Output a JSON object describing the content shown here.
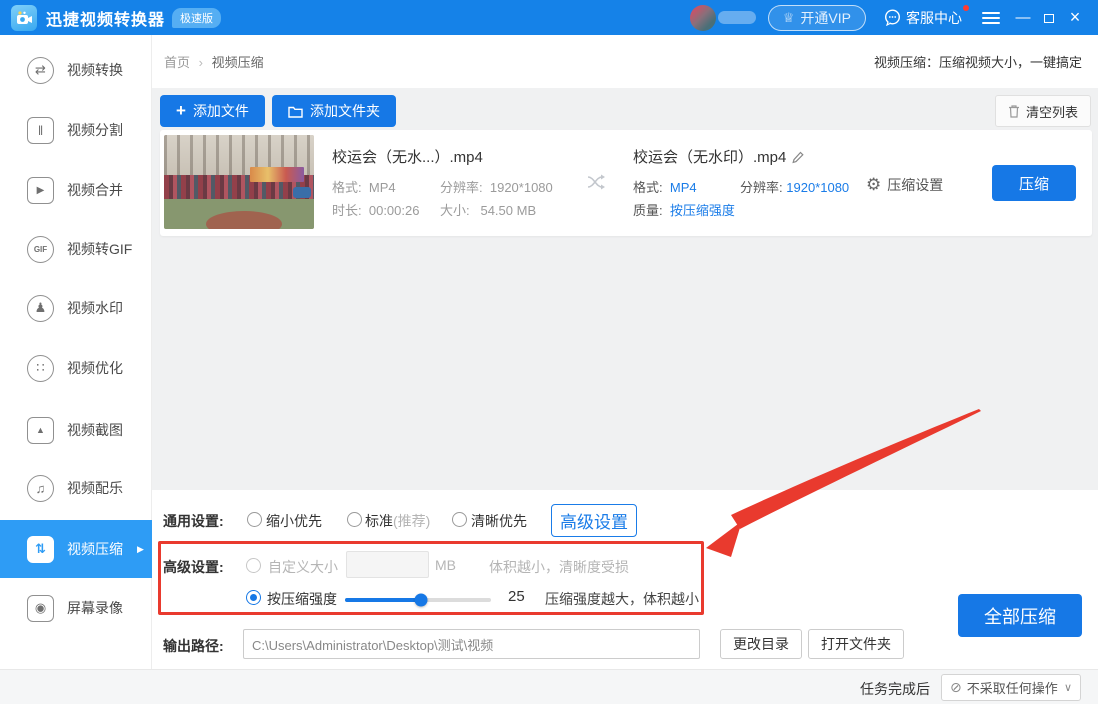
{
  "colors": {
    "titlebar_blue": "#1582e8",
    "accent_blue": "#1678e6",
    "sidebar_selected_blue": "#2e9cf5",
    "link_blue": "#1a7ce8",
    "annotation_red": "#e93a2e"
  },
  "titlebar": {
    "app_name": "迅捷视频转换器",
    "badge": "极速版",
    "vip_label": "开通VIP",
    "service_label": "客服中心"
  },
  "icons": {
    "crown": "♕",
    "plus": "+",
    "gear": "⚙",
    "prohibit": "⊘",
    "chevron_down": "∨",
    "minimize": "—",
    "close": "×",
    "submenu_arrow": "▶",
    "breadcrumb_sep": "›"
  },
  "sidebar": {
    "items": [
      {
        "label": "视频转换",
        "glyph": "⇄"
      },
      {
        "label": "视频分割",
        "glyph": "‖"
      },
      {
        "label": "视频合并",
        "glyph": "▶"
      },
      {
        "label": "视频转GIF",
        "glyph": "GIF"
      },
      {
        "label": "视频水印",
        "glyph": "♟"
      },
      {
        "label": "视频优化",
        "glyph": "∷"
      },
      {
        "label": "视频截图",
        "glyph": "▲"
      },
      {
        "label": "视频配乐",
        "glyph": "♫"
      },
      {
        "label": "视频压缩",
        "glyph": "⇅",
        "selected": true
      },
      {
        "label": "屏幕录像",
        "glyph": "◉"
      }
    ]
  },
  "breadcrumb": {
    "home": "首页",
    "current": "视频压缩"
  },
  "page_hint": "视频压缩：压缩视频大小，一键搞定",
  "toolbar": {
    "add_file": "添加文件",
    "add_folder": "添加文件夹",
    "clear": "清空列表"
  },
  "file": {
    "source": {
      "title": "校运会（无水...）.mp4",
      "format_label": "格式:",
      "format": "MP4",
      "res_label": "分辨率:",
      "resolution": "1920*1080",
      "dur_label": "时长:",
      "duration": "00:00:26",
      "size_label": "大小:",
      "size": "54.50 MB"
    },
    "target": {
      "title": "校运会（无水印）.mp4",
      "format_label": "格式:",
      "format": "MP4",
      "res_label": "分辨率:",
      "resolution": "1920*1080",
      "quality_label": "质量:",
      "quality": "按压缩强度"
    },
    "settings_label": "压缩设置",
    "compress_label": "压缩"
  },
  "general": {
    "label": "通用设置:",
    "opt1": "缩小优先",
    "opt2": "标准",
    "opt2_suffix": "(推荐)",
    "opt3": "清晰优先",
    "advanced_btn": "高级设置"
  },
  "advanced": {
    "label": "高级设置:",
    "custom_label": "自定义大小",
    "custom_value": "",
    "unit": "MB",
    "custom_hint": "体积越小，清晰度受损",
    "strength_label": "按压缩强度",
    "strength_value": "25",
    "strength_hint": "压缩强度越大，体积越小",
    "slider_percent": 52
  },
  "output": {
    "label": "输出路径:",
    "path": "C:\\Users\\Administrator\\Desktop\\测试\\视频",
    "change_btn": "更改目录",
    "open_btn": "打开文件夹"
  },
  "compress_all": "全部压缩",
  "statusbar": {
    "label": "任务完成后",
    "value": "不采取任何操作"
  }
}
